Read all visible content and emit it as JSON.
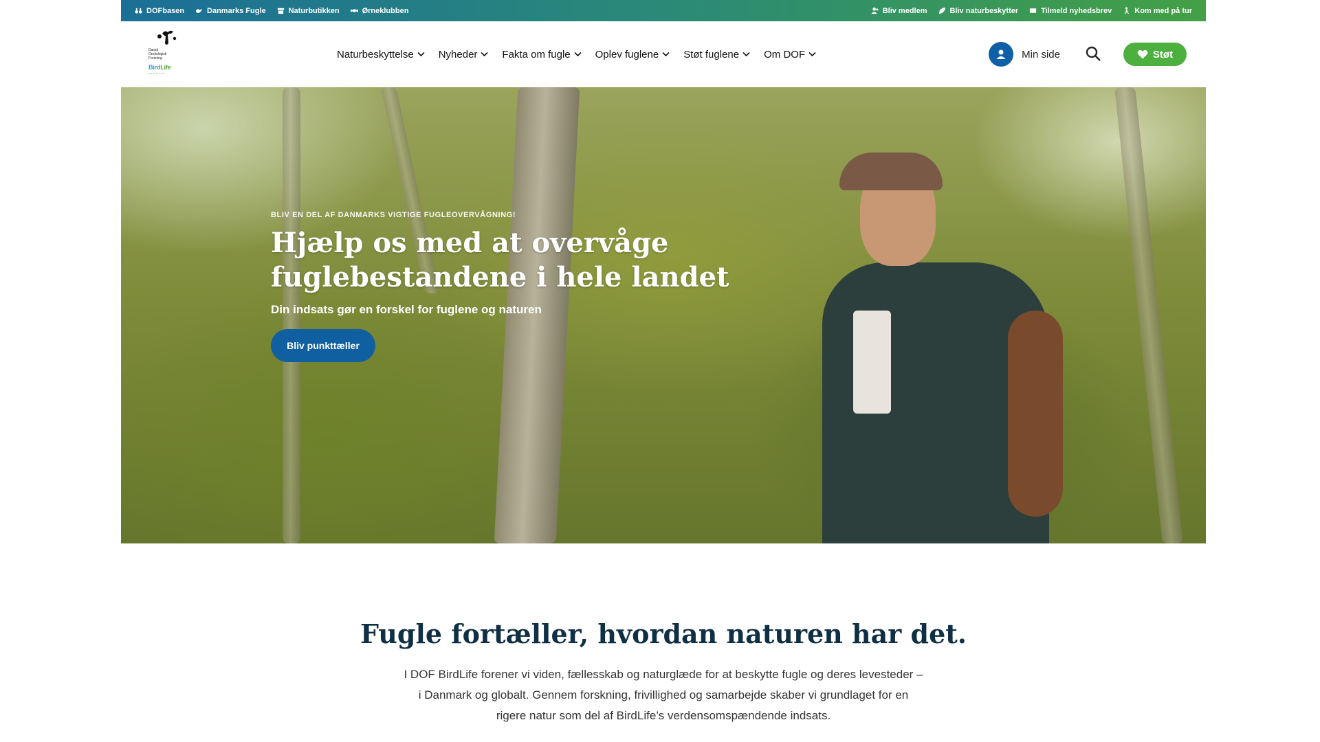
{
  "topbar": {
    "left_links": [
      {
        "label": "DOFbasen",
        "icon": "binoculars-icon"
      },
      {
        "label": "Danmarks Fugle",
        "icon": "bird-icon"
      },
      {
        "label": "Naturbutikken",
        "icon": "shop-icon"
      },
      {
        "label": "Ørneklubben",
        "icon": "eagle-icon"
      }
    ],
    "right_links": [
      {
        "label": "Bliv medlem",
        "icon": "add-user-icon"
      },
      {
        "label": "Bliv naturbeskytter",
        "icon": "leaf-icon"
      },
      {
        "label": "Tilmeld nyhedsbrev",
        "icon": "mail-icon"
      },
      {
        "label": "Kom med på tur",
        "icon": "walk-icon"
      }
    ]
  },
  "header": {
    "logo": {
      "line1": "Dansk",
      "line2": "Ornitologisk",
      "line3": "Forening",
      "birdlife_a": "Bird",
      "birdlife_b": "Life",
      "country": "DENMARK"
    },
    "nav": [
      {
        "label": "Naturbeskyttelse"
      },
      {
        "label": "Nyheder"
      },
      {
        "label": "Fakta om fugle"
      },
      {
        "label": "Oplev fuglene"
      },
      {
        "label": "Støt fuglene"
      },
      {
        "label": "Om DOF"
      }
    ],
    "min_side": "Min side",
    "support_button": "Støt"
  },
  "hero": {
    "kicker": "Bliv en del af Danmarks vigtige fugleovervågning!",
    "title": "Hjælp os med at overvåge fuglebestandene i hele landet",
    "subtitle": "Din indsats gør en forskel for fuglene og naturen",
    "button": "Bliv punkttæller"
  },
  "intro": {
    "title": "Fugle fortæller, hvordan naturen har det.",
    "text": "I DOF BirdLife forener vi viden, fællesskab og naturglæde for at beskytte fugle og deres levesteder – i Danmark og globalt. Gennem forskning, frivillighed og samarbejde skaber vi grundlaget for en rigere natur som del af BirdLife’s verdensomspændende indsats."
  },
  "colors": {
    "topbar_start": "#1b6f97",
    "topbar_end": "#43a045",
    "primary_blue": "#0f5fa1",
    "support_green": "#4caf3e",
    "heading_navy": "#0f2f45"
  }
}
